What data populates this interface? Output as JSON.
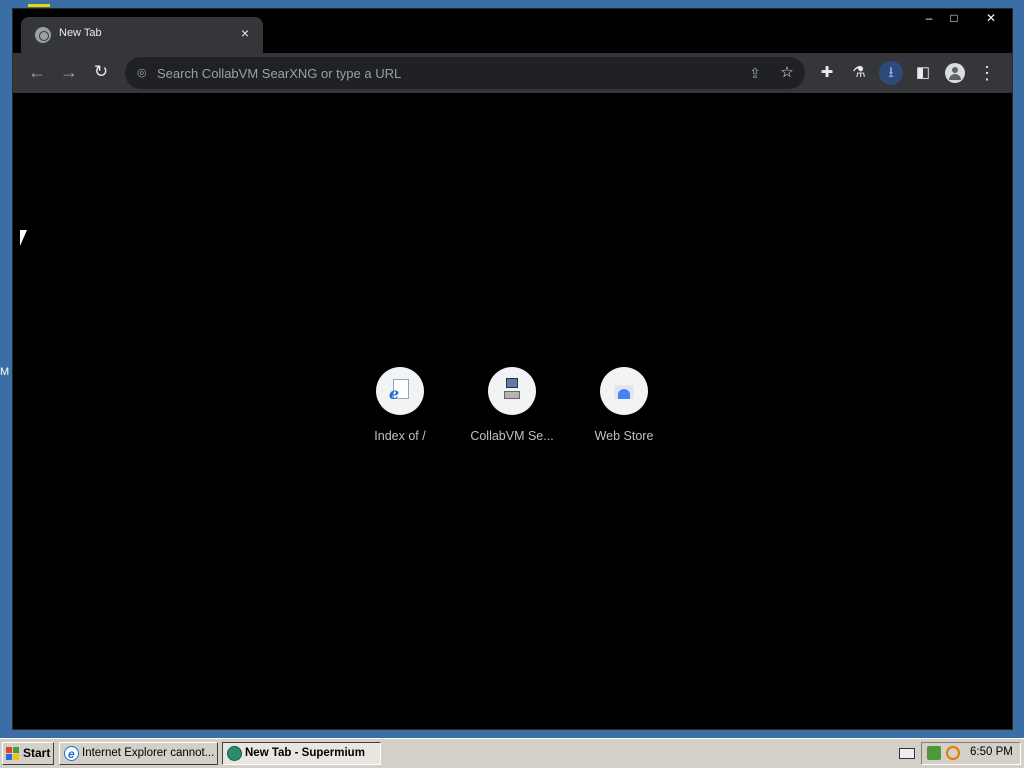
{
  "desktop": {
    "edge_text": "M"
  },
  "browser": {
    "tab": {
      "title": "New Tab",
      "close": "×"
    },
    "window_controls": {
      "minimize": "–",
      "maximize": "□",
      "close": "✕"
    },
    "toolbar": {
      "back": "←",
      "forward": "→",
      "reload": "↻",
      "omnibox_placeholder": "Search CollabVM SearXNG or type a URL",
      "omnibox_value": "",
      "share": "⇪",
      "bookmark": "☆",
      "extensions": "✚",
      "labs": "⚗",
      "download": "⭳",
      "side_panel": "◧",
      "menu": "⋮"
    },
    "shortcuts": [
      {
        "label": "Index of /",
        "icon": "ie-page-icon"
      },
      {
        "label": "CollabVM Se...",
        "icon": "computer-icon"
      },
      {
        "label": "Web Store",
        "icon": "web-store-icon"
      }
    ]
  },
  "taskbar": {
    "start_label": "Start",
    "tasks": [
      {
        "label": "Internet Explorer cannot...",
        "active": false
      },
      {
        "label": "New Tab - Supermium",
        "active": true
      }
    ],
    "clock": "6:50 PM"
  },
  "colors": {
    "desktop": "#3a6ea5",
    "toolbar": "#35363a",
    "omnibox": "#202124",
    "taskbar": "#d4d0c8"
  }
}
